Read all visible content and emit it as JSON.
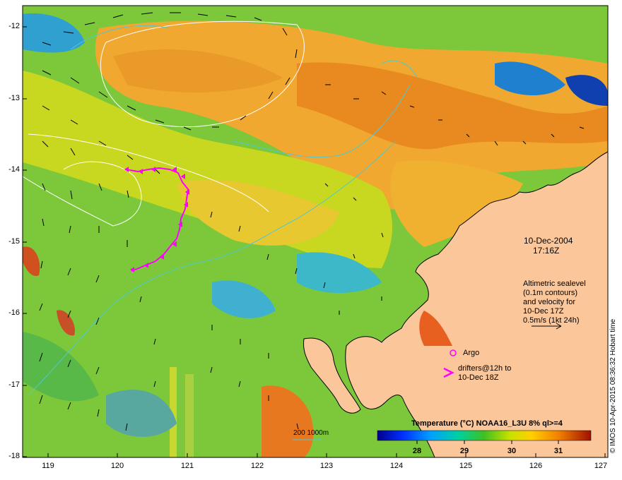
{
  "map": {
    "lon_ticks": [
      "119",
      "120",
      "121",
      "122",
      "123",
      "124",
      "125",
      "126",
      "127"
    ],
    "lat_ticks": [
      "-12",
      "-13",
      "-14",
      "-15",
      "-16",
      "-17",
      "-18"
    ]
  },
  "annotation": {
    "date": "10-Dec-2004",
    "time": "17:16Z",
    "alt_lines": [
      "Altimetric sealevel",
      "(0.1m contours)",
      "and velocity for",
      "10-Dec 17Z",
      "0.5m/s (1kt 24h)"
    ],
    "argo_label": "Argo",
    "drifters_lines": [
      "drifters@12h to",
      "10-Dec 18Z"
    ],
    "depth_label": "200  1000m"
  },
  "colorbar": {
    "title": "Temperature (°C) NOAA16_L3U 8% ql>=4",
    "ticks": [
      "28",
      "29",
      "30",
      "31"
    ]
  },
  "credit": "© IMOS 10-Apr-2015 08:36:32 Hobart time",
  "colors": {
    "land": "#fbc79a",
    "drifter": "#ff00ff",
    "contour": "#50c8d0",
    "white_contour": "#ffffff"
  }
}
